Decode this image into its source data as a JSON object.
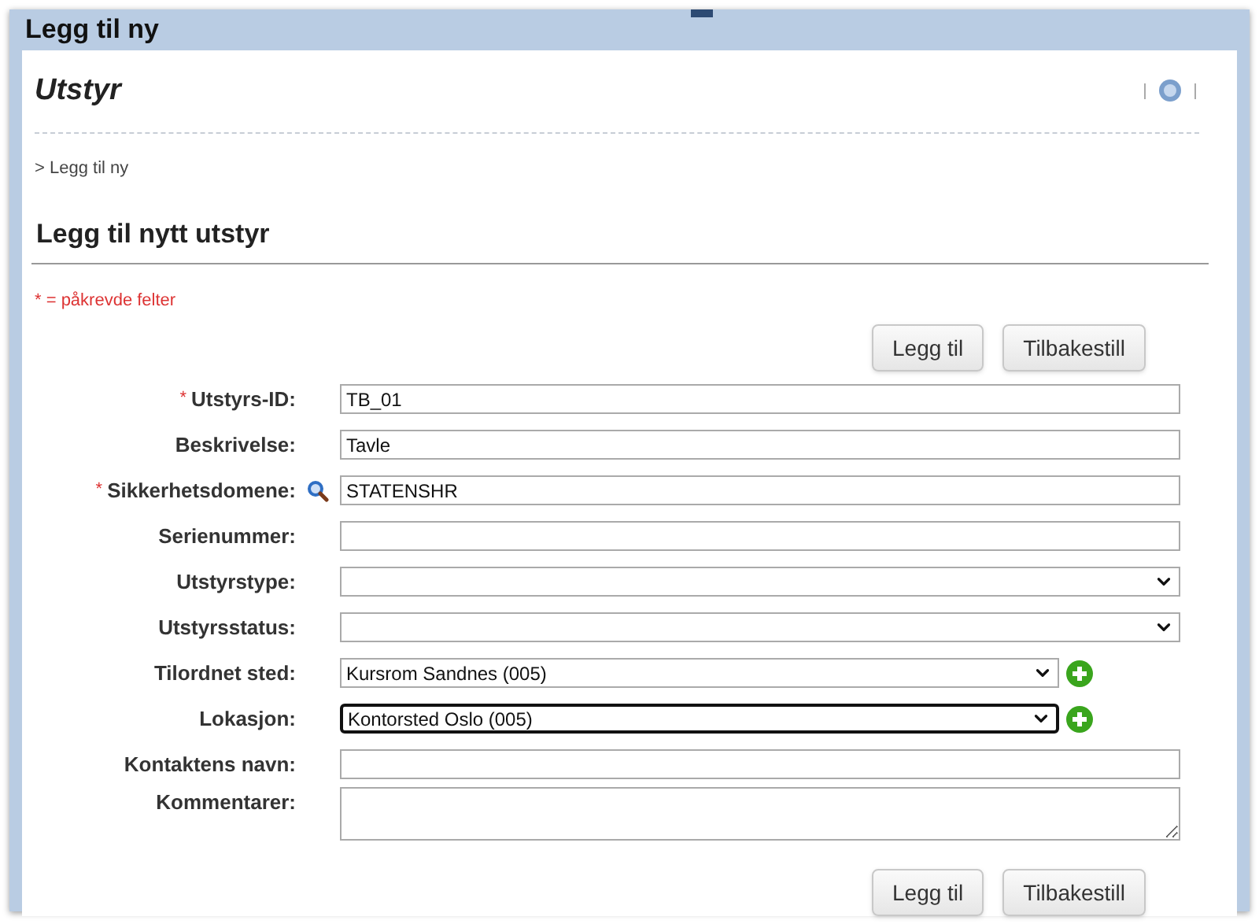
{
  "window": {
    "title": "Legg til ny"
  },
  "page": {
    "title": "Utstyr",
    "breadcrumb": "> Legg til ny",
    "section_title": "Legg til nytt utstyr",
    "required_note": "* = påkrevde felter"
  },
  "buttons": [
    "Legg til",
    "Tilbakestill"
  ],
  "fields": [
    {
      "kind": "text",
      "label": "Utstyrs-ID:",
      "required_mark": "*",
      "lookup": false,
      "add": false,
      "focused": false,
      "value": "TB_01"
    },
    {
      "kind": "text",
      "label": "Beskrivelse:",
      "lookup": false,
      "add": false,
      "focused": false,
      "value": "Tavle"
    },
    {
      "kind": "text",
      "label": "Sikkerhetsdomene:",
      "required_mark": "*",
      "lookup": true,
      "add": false,
      "focused": false,
      "value": "STATENSHR"
    },
    {
      "kind": "text",
      "label": "Serienummer:",
      "lookup": false,
      "add": false,
      "focused": false
    },
    {
      "kind": "select",
      "label": "Utstyrstype:",
      "lookup": false,
      "add": false,
      "focused": false
    },
    {
      "kind": "select",
      "label": "Utstyrsstatus:",
      "lookup": false,
      "add": false,
      "focused": false
    },
    {
      "kind": "select",
      "label": "Tilordnet sted:",
      "lookup": false,
      "add": true,
      "focused": false,
      "value": "Kursrom Sandnes (005)"
    },
    {
      "kind": "select",
      "label": "Lokasjon:",
      "lookup": false,
      "add": true,
      "focused": true,
      "value": "Kontorsted Oslo (005)"
    },
    {
      "kind": "text",
      "label": "Kontaktens navn:",
      "lookup": false,
      "add": false,
      "focused": false
    },
    {
      "kind": "textarea",
      "label": "Kommentarer:",
      "lookup": false,
      "add": false,
      "focused": false
    }
  ],
  "bottom_buttons": [
    "Legg til",
    "Tilbakestill"
  ]
}
